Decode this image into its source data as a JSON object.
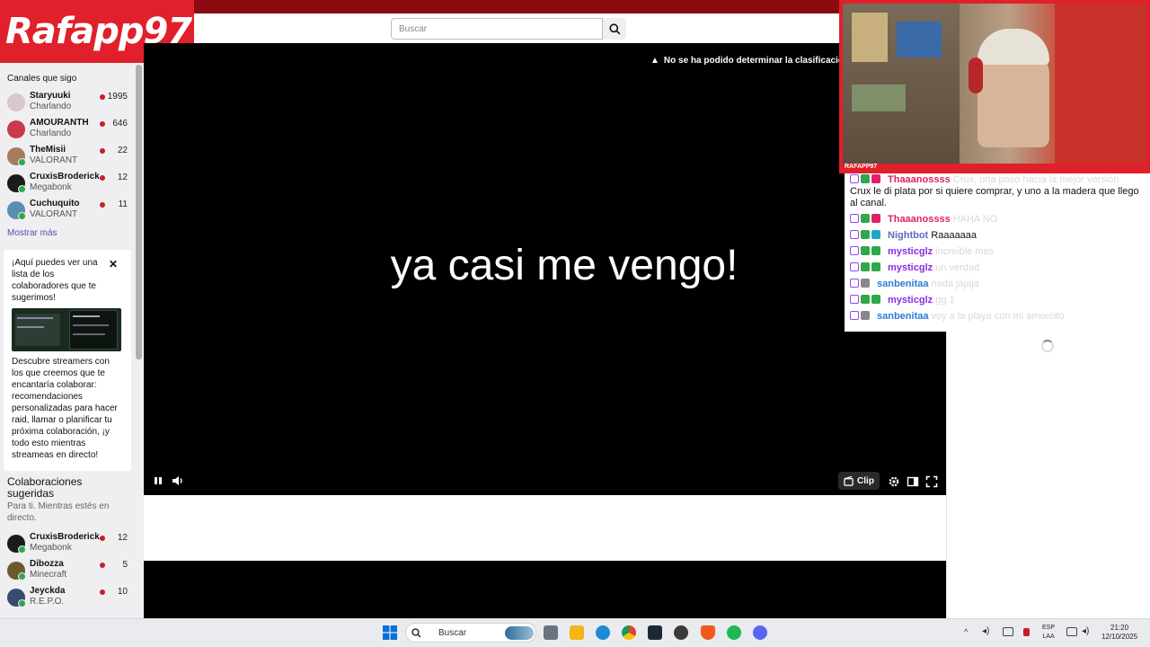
{
  "overlay": {
    "logo_text": "Rafapp97",
    "cam_tag": "RAFAPP97"
  },
  "header": {
    "search_placeholder": "Buscar"
  },
  "sidebar": {
    "following_title": "Canales que sigo",
    "channels": [
      {
        "name": "Staryuuki",
        "game": "Charlando",
        "viewers": "1995"
      },
      {
        "name": "AMOURANTH",
        "game": "Charlando",
        "viewers": "646"
      },
      {
        "name": "TheMisii",
        "game": "VALORANT",
        "viewers": "22"
      },
      {
        "name": "CruxisBroderick",
        "game": "Megabonk",
        "viewers": "12"
      },
      {
        "name": "Cuchuquito",
        "game": "VALORANT",
        "viewers": "11"
      }
    ],
    "show_more": "Mostrar más",
    "promo": {
      "title": "¡Aquí puedes ver una lista de los colaboradores que te sugerimos!",
      "body": "Descubre streamers con los que creemos que te encantaría colaborar: recomendaciones personalizadas para hacer raid, llamar o planificar tu próxima colaboración, ¡y todo esto mientras streameas en directo!"
    },
    "collab_title": "Colaboraciones sugeridas",
    "collab_subtitle": "Para ti. Mientras estés en directo.",
    "collabs": [
      {
        "name": "CruxisBroderick",
        "game": "Megabonk",
        "viewers": "12"
      },
      {
        "name": "Dibozza",
        "game": "Minecraft",
        "viewers": "5"
      },
      {
        "name": "Jeyckda",
        "game": "R.E.P.O.",
        "viewers": "10"
      }
    ]
  },
  "player": {
    "warning": "No se ha podido determinar la clasificación",
    "caption": "ya casi me vengo!",
    "clip_label": "Clip"
  },
  "chat": {
    "first_message": "Crux le di plata por si quiere comprar, y uno a la madera que llego al canal.",
    "messages": [
      {
        "user": "Thaaanossss",
        "text": "HAHA NO",
        "color": "#e0206b"
      },
      {
        "user": "Nightbot",
        "text": "Raaaaaaa",
        "color": "#5c6bc0"
      },
      {
        "user": "mysticglz",
        "text": "increible mas",
        "color": "#8a2be2"
      },
      {
        "user": "mysticglz",
        "text": "un verdad",
        "color": "#8a2be2"
      },
      {
        "user": "sanbenitaa",
        "text": "nada jajaja",
        "color": "#2e7ad6"
      },
      {
        "user": "mysticglz",
        "text": "gg 1",
        "color": "#8a2be2"
      },
      {
        "user": "sanbenitaa",
        "text": "voy a la playa con mi amorcito",
        "color": "#2e7ad6"
      }
    ],
    "top_user": "Thaaanossss",
    "top_text": "Crux, una paso hacia la mejor version"
  },
  "taskbar": {
    "search_label": "Buscar",
    "lang_top": "ESP",
    "lang_bottom": "LAA",
    "time": "21:20",
    "date": "12/10/2025"
  },
  "colors": {
    "brand_red": "#e0202a",
    "twitch_purple": "#9146ff",
    "live_red": "#c81e28"
  }
}
